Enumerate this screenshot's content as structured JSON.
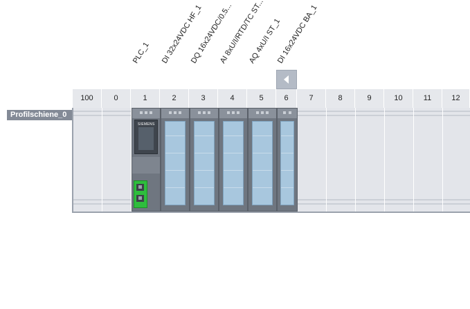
{
  "rail": {
    "label": "Profilschiene_0"
  },
  "slots": [
    "100",
    "0",
    "1",
    "2",
    "3",
    "4",
    "5",
    "6",
    "7",
    "8",
    "9",
    "10",
    "11",
    "12"
  ],
  "modules": [
    {
      "name": "PLC_1",
      "slot": "1",
      "kind": "cpu",
      "brand": "SIEMENS"
    },
    {
      "name": "DI 32x24VDC HF_1",
      "slot": "2",
      "kind": "io"
    },
    {
      "name": "DQ 16x24VDC/0.5...",
      "slot": "3",
      "kind": "io"
    },
    {
      "name": "AI 8xU/I/RTD/TC ST...",
      "slot": "4",
      "kind": "io"
    },
    {
      "name": "AQ 4xU/I ST_1",
      "slot": "5",
      "kind": "io"
    },
    {
      "name": "DI 16x24VDC BA_1",
      "slot": "6",
      "kind": "io-narrow"
    }
  ],
  "nav": {
    "icon": "chevron-left-icon"
  }
}
